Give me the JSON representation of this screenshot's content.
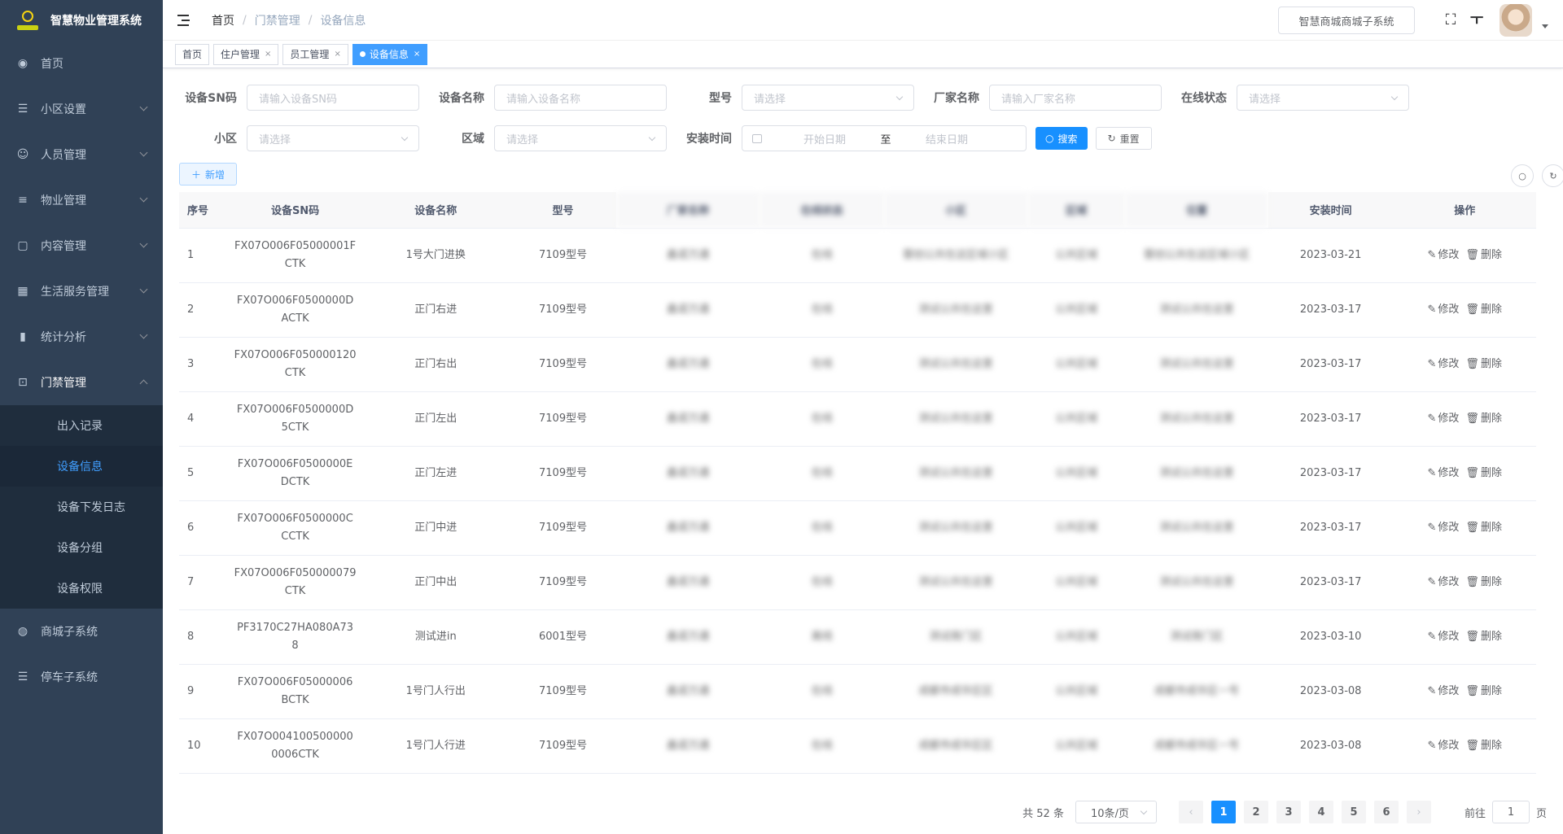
{
  "app": {
    "title": "智慧物业管理系统"
  },
  "sidebar": {
    "items": [
      {
        "label": "首页",
        "icon": "dashboard-icon",
        "glyph": "◉"
      },
      {
        "label": "小区设置",
        "icon": "list-icon",
        "glyph": "☰",
        "expandable": true
      },
      {
        "label": "人员管理",
        "icon": "people-icon",
        "glyph": "☺",
        "expandable": true
      },
      {
        "label": "物业管理",
        "icon": "sliders-icon",
        "glyph": "≡",
        "expandable": true
      },
      {
        "label": "内容管理",
        "icon": "message-icon",
        "glyph": "▢",
        "expandable": true
      },
      {
        "label": "生活服务管理",
        "icon": "grid-icon",
        "glyph": "▦",
        "expandable": true
      },
      {
        "label": "统计分析",
        "icon": "chart-icon",
        "glyph": "▮",
        "expandable": true
      },
      {
        "label": "门禁管理",
        "icon": "lock-icon",
        "glyph": "⊡",
        "expandable": true,
        "open": true
      }
    ],
    "submenu": [
      {
        "label": "出入记录"
      },
      {
        "label": "设备信息",
        "active": true
      },
      {
        "label": "设备下发日志"
      },
      {
        "label": "设备分组"
      },
      {
        "label": "设备权限"
      }
    ],
    "bottom_items": [
      {
        "label": "商城子系统",
        "icon": "globe-icon",
        "glyph": "◍"
      },
      {
        "label": "停车子系统",
        "icon": "list-icon",
        "glyph": "☰"
      }
    ]
  },
  "navbar": {
    "breadcrumb": [
      "首页",
      "门禁管理",
      "设备信息"
    ],
    "sub_system_button": "智慧商城商城子系统"
  },
  "tags": [
    {
      "label": "首页",
      "closable": false
    },
    {
      "label": "住户管理",
      "closable": true
    },
    {
      "label": "员工管理",
      "closable": true
    },
    {
      "label": "设备信息",
      "closable": true,
      "active": true
    }
  ],
  "filters": {
    "sn": {
      "label": "设备SN码",
      "placeholder": "请输入设备SN码"
    },
    "name": {
      "label": "设备名称",
      "placeholder": "请输入设备名称"
    },
    "model": {
      "label": "型号",
      "placeholder": "请选择"
    },
    "vendor": {
      "label": "厂家名称",
      "placeholder": "请输入厂家名称"
    },
    "online": {
      "label": "在线状态",
      "placeholder": "请选择"
    },
    "community": {
      "label": "小区",
      "placeholder": "请选择"
    },
    "area": {
      "label": "区域",
      "placeholder": "请选择"
    },
    "install": {
      "label": "安装时间",
      "start_placeholder": "开始日期",
      "separator": "至",
      "end_placeholder": "结束日期"
    },
    "search_button": "搜索",
    "reset_button": "重置"
  },
  "toolbar": {
    "add_button": "新增"
  },
  "table": {
    "columns": [
      "序号",
      "设备SN码",
      "设备名称",
      "型号",
      "厂家名称",
      "在线状态",
      "小区",
      "区域",
      "位置",
      "安装时间",
      "操作"
    ],
    "rows": [
      {
        "no": "1",
        "sn": "FX07O006F05000001FCTK",
        "name": "1号大门进换",
        "model": "7109型号",
        "vendor": "鑫诺万通",
        "status": "在线",
        "community": "蓉创公共在这区域小区",
        "area": "公共区域",
        "location": "蓉创公共在这区域小区",
        "date": "2023-03-21"
      },
      {
        "no": "2",
        "sn": "FX07O006F0500000DACTK",
        "name": "正门右进",
        "model": "7109型号",
        "vendor": "鑫诺万通",
        "status": "在线",
        "community": "测试公共在这里",
        "area": "公共区域",
        "location": "测试公共在这里",
        "date": "2023-03-17"
      },
      {
        "no": "3",
        "sn": "FX07O006F050000120CTK",
        "name": "正门右出",
        "model": "7109型号",
        "vendor": "鑫诺万通",
        "status": "在线",
        "community": "测试公共在这里",
        "area": "公共区域",
        "location": "测试公共在这里",
        "date": "2023-03-17"
      },
      {
        "no": "4",
        "sn": "FX07O006F0500000D5CTK",
        "name": "正门左出",
        "model": "7109型号",
        "vendor": "鑫诺万通",
        "status": "在线",
        "community": "测试公共在这里",
        "area": "公共区域",
        "location": "测试公共在这里",
        "date": "2023-03-17"
      },
      {
        "no": "5",
        "sn": "FX07O006F0500000EDCTK",
        "name": "正门左进",
        "model": "7109型号",
        "vendor": "鑫诺万通",
        "status": "在线",
        "community": "测试公共在这里",
        "area": "公共区域",
        "location": "测试公共在这里",
        "date": "2023-03-17"
      },
      {
        "no": "6",
        "sn": "FX07O006F0500000CCCTK",
        "name": "正门中进",
        "model": "7109型号",
        "vendor": "鑫诺万通",
        "status": "在线",
        "community": "测试公共在这里",
        "area": "公共区域",
        "location": "测试公共在这里",
        "date": "2023-03-17"
      },
      {
        "no": "7",
        "sn": "FX07O006F050000079CTK",
        "name": "正门中出",
        "model": "7109型号",
        "vendor": "鑫诺万通",
        "status": "在线",
        "community": "测试公共在这里",
        "area": "公共区域",
        "location": "测试公共在这里",
        "date": "2023-03-17"
      },
      {
        "no": "8",
        "sn": "PF3170C27HA080A738",
        "name": "测试进in",
        "model": "6001型号",
        "vendor": "鑫诺万通",
        "status": "离线",
        "community": "测试南门区",
        "area": "公共区域",
        "location": "测试南门区",
        "date": "2023-03-10"
      },
      {
        "no": "9",
        "sn": "FX07O006F05000006BCTK",
        "name": "1号门人行出",
        "model": "7109型号",
        "vendor": "鑫诺万通",
        "status": "在线",
        "community": "成都市成华区区",
        "area": "公共区域",
        "location": "成都市成华区一号",
        "date": "2023-03-08"
      },
      {
        "no": "10",
        "sn": "FX07O0041005000000006CTK",
        "name": "1号门人行进",
        "model": "7109型号",
        "vendor": "鑫诺万通",
        "status": "在线",
        "community": "成都市成华区区",
        "area": "公共区域",
        "location": "成都市成华区一号",
        "date": "2023-03-08"
      }
    ],
    "edit_label": "修改",
    "delete_label": "删除"
  },
  "pagination": {
    "total_text": "共 52 条",
    "page_size": "10条/页",
    "pages": [
      "1",
      "2",
      "3",
      "4",
      "5",
      "6"
    ],
    "current": "1",
    "goto_prefix": "前往",
    "goto_value": "1",
    "goto_suffix": "页"
  },
  "colors": {
    "sidebar_bg": "#304156",
    "primary": "#1890ff",
    "active_tag": "#409eff"
  }
}
